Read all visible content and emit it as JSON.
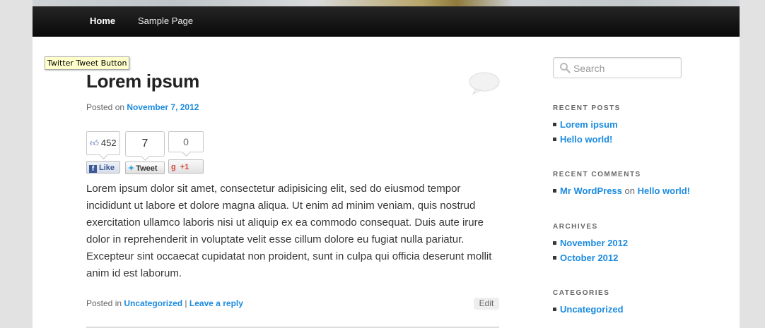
{
  "nav": {
    "home_label": "Home",
    "sample_label": "Sample Page"
  },
  "tooltip": "Twitter Tweet Button",
  "post": {
    "title": "Lorem ipsum",
    "posted_on_prefix": "Posted on",
    "date": "November 7, 2012",
    "body": "Lorem ipsum dolor sit amet, consectetur adipisicing elit, sed do eiusmod tempor incididunt ut labore et dolore magna aliqua. Ut enim ad minim veniam, quis nostrud exercitation ullamco laboris nisi ut aliquip ex ea commodo consequat. Duis aute irure dolor in reprehenderit in voluptate velit esse cillum dolore eu fugiat nulla pariatur. Excepteur sint occaecat cupidatat non proident, sunt in culpa qui officia deserunt mollit anim id est laborum.",
    "posted_in_prefix": "Posted in",
    "category": "Uncategorized",
    "separator": "|",
    "reply_label": "Leave a reply",
    "edit_label": "Edit"
  },
  "share": {
    "fb_count": "452",
    "fb_label": "Like",
    "tw_count": "7",
    "tw_label": "Tweet",
    "gp_count": "0",
    "gp_label": "+1"
  },
  "sidebar": {
    "search_placeholder": "Search",
    "recent_posts_title": "Recent Posts",
    "recent_posts": [
      "Lorem ipsum",
      "Hello world!"
    ],
    "recent_comments_title": "Recent Comments",
    "recent_comment": {
      "author": "Mr WordPress",
      "on": "on",
      "post": "Hello world!"
    },
    "archives_title": "Archives",
    "archives": [
      "November 2012",
      "October 2012"
    ],
    "categories_title": "Categories",
    "categories": [
      "Uncategorized"
    ]
  },
  "colors": {
    "link": "#1b8be0",
    "nav_bg": "#111111",
    "text": "#373737"
  },
  "icons": [
    "comment-bubble-icon",
    "search-icon",
    "facebook-icon",
    "twitter-bird-icon",
    "google-plus-icon",
    "thumbs-up-icon"
  ]
}
